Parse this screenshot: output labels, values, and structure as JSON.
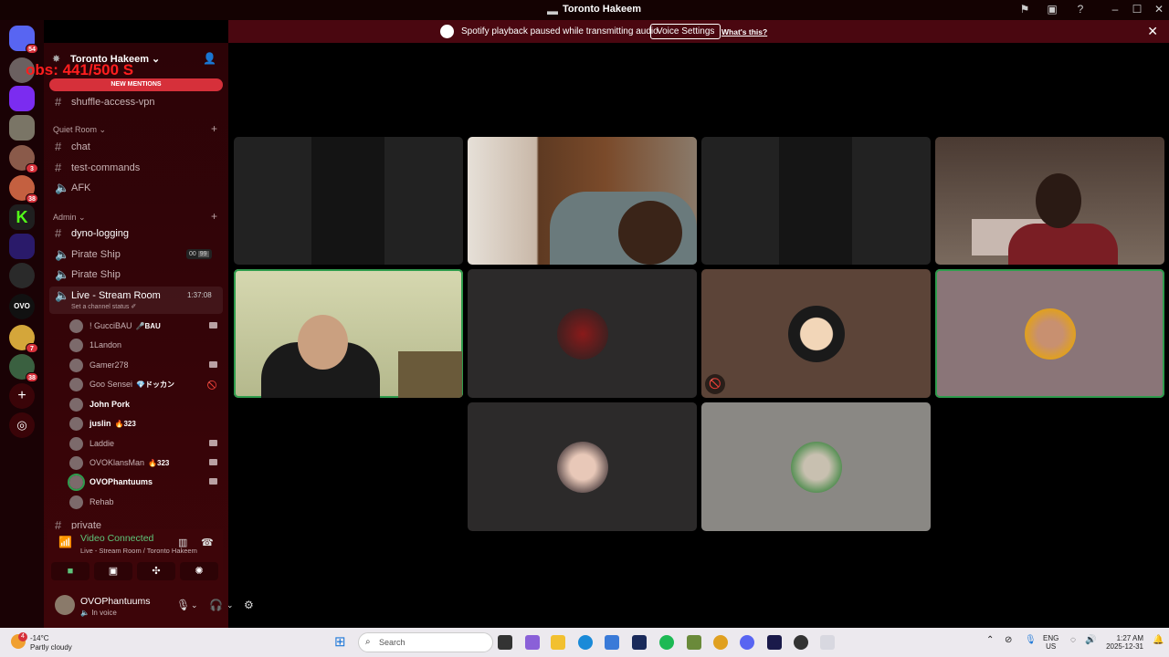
{
  "window": {
    "title": "Toronto Hakeem"
  },
  "notice": {
    "message": "Spotify playback paused while transmitting audio.",
    "button_label": "Voice Settings",
    "link_label": "What's this?"
  },
  "rail": {
    "home_badge": "54",
    "badges": [
      "3",
      "38",
      "7",
      "38"
    ]
  },
  "sidebar": {
    "server_name": "Toronto Hakeem",
    "server_chevron": "⌄",
    "overlay_text": "obs: 441/500  S",
    "new_mentions": "NEW MENTIONS",
    "top_channel": "shuffle-access-vpn",
    "categories": [
      {
        "name": "Quiet Room ⌄",
        "channels": [
          "chat",
          "test-commands",
          "AFK"
        ]
      },
      {
        "name": "Admin ⌄",
        "channels": [
          "dyno-logging",
          "Pirate Ship",
          "Pirate Ship"
        ]
      }
    ],
    "pirate_counts": [
      "00",
      "99"
    ],
    "live_channel": {
      "name": "Live - Stream Room",
      "timer": "1:37:08",
      "status": "Set a channel status ✐"
    },
    "voice_users": [
      {
        "name": "! GucciBAU",
        "tag": "🎤BAU"
      },
      {
        "name": "1Landon",
        "tag": ""
      },
      {
        "name": "Gamer278",
        "tag": ""
      },
      {
        "name": "Goo Sensei",
        "tag": "💎ドッカン"
      },
      {
        "name": "John Pork",
        "tag": ""
      },
      {
        "name": "juslin",
        "tag": "🔥323"
      },
      {
        "name": "Laddie",
        "tag": ""
      },
      {
        "name": "OVOKlansMan",
        "tag": "🔥323"
      },
      {
        "name": "OVOPhantuums",
        "tag": ""
      },
      {
        "name": "Rehab",
        "tag": ""
      }
    ],
    "next_category": "private"
  },
  "voice": {
    "status": "Video Connected",
    "location": "Live - Stream Room / Toronto Hakeem"
  },
  "userbar": {
    "name": "OVOPhantuums",
    "status": "In voice"
  },
  "taskbar": {
    "temp": "-14°C",
    "weather": "Partly cloudy",
    "weather_badge": "4",
    "search_placeholder": "Search",
    "lang": "ENG",
    "region": "US",
    "time": "1:27 AM",
    "date": "2025-12-31"
  },
  "colors": {
    "accent_red": "#d6303a",
    "sidebar_bg": "#3d0509",
    "speaking_green": "#2f9c4d"
  }
}
